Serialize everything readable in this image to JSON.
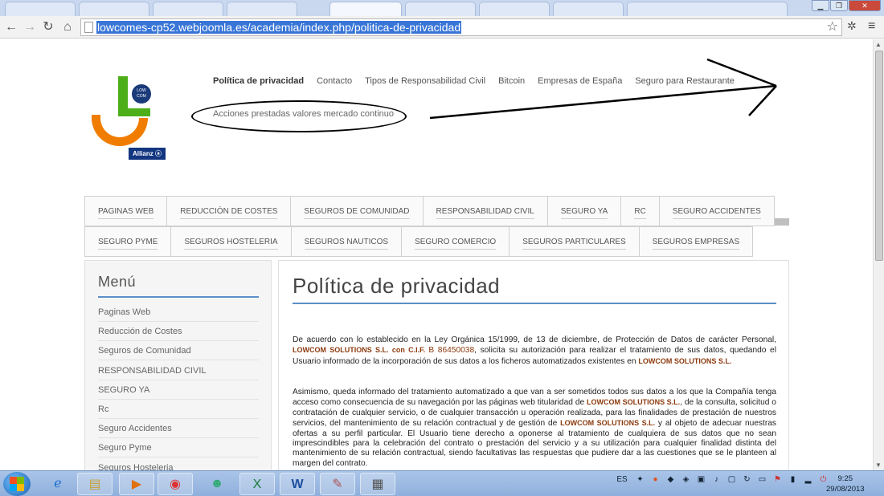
{
  "browser": {
    "url": "lowcomes-cp52.webjoomla.es/academia/index.php/politica-de-privacidad",
    "icons": [
      "back-icon",
      "forward-icon",
      "reload-icon",
      "home-icon",
      "star-icon",
      "extension-icon",
      "menu-icon"
    ]
  },
  "logo": {
    "badge_line1": "LOW",
    "badge_line2": "COM",
    "allianz": "Allianz ⓐ"
  },
  "topnav": {
    "items": [
      {
        "label": "Política de privacidad",
        "active": true
      },
      {
        "label": "Contacto"
      },
      {
        "label": "Tipos de Responsabilidad Civil"
      },
      {
        "label": "Bitcoin"
      },
      {
        "label": "Empresas de España"
      },
      {
        "label": "Seguro para Restaurante"
      }
    ],
    "row2": "Acciones prestadas valores mercado continuo"
  },
  "mainmenu": {
    "row1": [
      "PAGINAS WEB",
      "REDUCCIÓN DE COSTES",
      "SEGUROS DE COMUNIDAD",
      "RESPONSABILIDAD CIVIL",
      "SEGURO YA",
      "RC",
      "SEGURO ACCIDENTES"
    ],
    "row2": [
      "SEGURO PYME",
      "SEGUROS HOSTELERIA",
      "SEGUROS NAUTICOS",
      "SEGURO COMERCIO",
      "SEGUROS PARTICULARES",
      "SEGUROS EMPRESAS"
    ]
  },
  "sidebar": {
    "title": "Menú",
    "items": [
      "Paginas Web",
      "Reducción de Costes",
      "Seguros de Comunidad",
      "RESPONSABILIDAD CIVIL",
      "SEGURO YA",
      "Rc",
      "Seguro Accidentes",
      "Seguro Pyme",
      "Seguros Hosteleria"
    ]
  },
  "content": {
    "title": "Política de privacidad",
    "p1_a": "De acuerdo con lo establecido en la Ley Orgánica 15/1999, de 13 de diciembre, de Protección de Datos de carácter Personal, ",
    "org": "LOWCOM SOLUTIONS S.L.",
    "p1_cif_label": " con C.I.F. ",
    "p1_cif": "B 86450038",
    "p1_b": ", solicita su autorización para realizar el tratamiento de sus datos, quedando el Usuario informado de la incorporación de sus datos a los ficheros automatizados existentes en ",
    "p2_a": "Asimismo, queda informado del tratamiento automatizado a que van a ser sometidos todos sus datos a los que la Compañía tenga acceso como consecuencia de su navegación por las páginas web titularidad de ",
    "p2_b": ", de la consulta, solicitud o contratación de cualquier servicio, o de cualquier transacción u operación realizada, para las finalidades de prestación de nuestros servicios, del mantenimiento de su relación contractual y de gestión de ",
    "p2_c": " y al objeto de adecuar nuestras ofertas a su perfil particular. El Usuario tiene derecho a oponerse al tratamiento de cualquiera de sus datos que no sean imprescindibles para la celebración del contrato o prestación del servicio y a su utilización para cualquier finalidad distinta del mantenimiento de su relación contractual, siendo facultativas las respuestas que pudiere dar a las cuestiones que se le planteen al margen del contrato."
  },
  "taskbar": {
    "apps": [
      "internet-explorer-icon",
      "file-explorer-icon",
      "media-player-icon",
      "chrome-icon",
      "users-icon",
      "excel-icon",
      "word-icon",
      "paint-icon",
      "calculator-icon"
    ],
    "language": "ES",
    "time": "9:25",
    "date": "29/08/2013"
  },
  "colors": {
    "accent_blue": "#5c8fc9",
    "org_brown": "#8b3a0e",
    "url_highlight": "#3875d7",
    "logo_green": "#4caf1a",
    "logo_orange": "#f07d00"
  }
}
